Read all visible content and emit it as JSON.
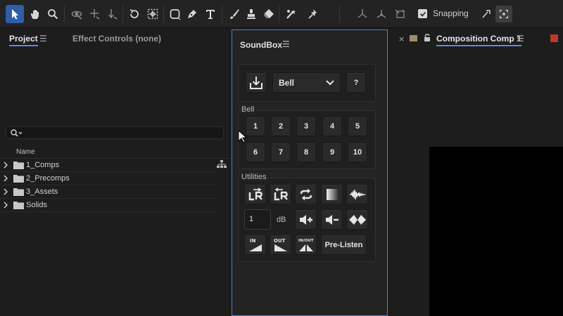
{
  "toolbar": {
    "snapping_label": "Snapping",
    "snapping_checked": true,
    "accent": "#2d5ea8"
  },
  "project_panel": {
    "tab_project": "Project",
    "tab_effect_controls": "Effect Controls (none)",
    "menu_glyph": "☰",
    "column_name": "Name",
    "items": [
      {
        "label": "1_Comps"
      },
      {
        "label": "2_Precomps"
      },
      {
        "label": "3_Assets"
      },
      {
        "label": "Solids"
      }
    ]
  },
  "soundbox": {
    "title": "SoundBox",
    "menu_glyph": "☰",
    "selected_sound": "Bell",
    "help_label": "?",
    "bell_group_label": "Bell",
    "bell_buttons": [
      "1",
      "2",
      "3",
      "4",
      "5",
      "6",
      "7",
      "8",
      "9",
      "10"
    ],
    "utilities_label": "Utilities",
    "utility_icons": [
      "swap-lr-right-icon",
      "swap-lr-left-icon",
      "repeat-icon",
      "gradient-icon",
      "waveform-icon"
    ],
    "db_value": "1",
    "db_unit": "dB",
    "volume_icons": [
      "volume-up-icon",
      "volume-down-icon",
      "crossfade-icon"
    ],
    "fade_in_label": "IN",
    "fade_out_label": "OUT",
    "fade_inout_label": "IN/OUT",
    "prelisten_label": "Pre-Listen",
    "border_color": "#4b7fd0"
  },
  "composition": {
    "close_glyph": "×",
    "title": "Composition Comp 1",
    "menu_glyph": "☰",
    "label_color": "#c0362c"
  }
}
